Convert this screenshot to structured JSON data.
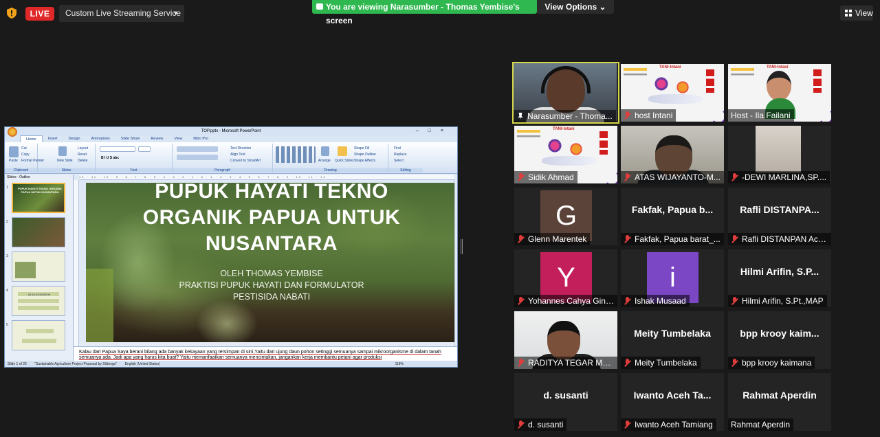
{
  "topbar": {
    "live_label": "LIVE",
    "stream_service": "Custom Live Streaming Service",
    "viewing_banner": "You are viewing Narasumber - Thomas Yembise's screen",
    "view_options": "View Options",
    "view_button": "View"
  },
  "ppt": {
    "window_title": "TOP.pptx - Microsoft PowerPoint",
    "tabs": [
      "Home",
      "Insert",
      "Design",
      "Animations",
      "Slide Show",
      "Review",
      "View",
      "Nitro Pro"
    ],
    "groups": [
      "Clipboard",
      "Slides",
      "Font",
      "Paragraph",
      "Drawing",
      "Editing"
    ],
    "clipboard": {
      "paste": "Paste",
      "cut": "Cut",
      "copy": "Copy",
      "format_painter": "Format Painter"
    },
    "slides_group": {
      "new_slide": "New Slide",
      "layout": "Layout",
      "reset": "Reset",
      "delete": "Delete"
    },
    "paragraph": {
      "text_direction": "Text Direction",
      "align_text": "Align Text",
      "convert": "Convert to SmartArt"
    },
    "drawing": {
      "arrange": "Arrange",
      "quick_styles": "Quick Styles",
      "shape_fill": "Shape Fill",
      "shape_outline": "Shape Outline",
      "shape_effects": "Shape Effects"
    },
    "editing": {
      "find": "Find",
      "replace": "Replace",
      "select": "Select"
    },
    "pane_tabs": [
      "Slides",
      "Outline"
    ],
    "thumbs": [
      {
        "num": "1",
        "text": "PUPUK HAYATI TEKNO ORGANIK PAPUA UNTUK NUSANTARA"
      },
      {
        "num": "2",
        "text": ""
      },
      {
        "num": "3",
        "text": ""
      },
      {
        "num": "4",
        "text": "01 02 03 04 05 06"
      },
      {
        "num": "5",
        "text": ""
      }
    ],
    "slide": {
      "title": "PUPUK HAYATI TEKNO ORGANIK PAPUA UNTUK NUSANTARA",
      "line1": "OLEH THOMAS YEMBISE",
      "line2": "PRAKTISI PUPUK HAYATI DAN FORMULATOR",
      "line3": "PESTISIDA NABATI"
    },
    "notes": "Kalau dari Papua Saya berani bilang ada banyak kekayaan yang tersimpan di sini,Yaitu dari ujung daun pohon setinggi semuanya sampai mikroorganisme di dalam tanah semuanya ada. Jadi apa yang harus kita buat? Yaitu memanfaatkan semuanya mencintakan, jangankan kerja membantu petani agar produksi",
    "status": {
      "slide": "Slide 1 of 26",
      "theme": "\"Sustainable Agriculture Project Proposal by Slidesgo\"",
      "lang": "English (United States)",
      "zoom": "118%"
    }
  },
  "tiles": [
    {
      "name": "Narasumber - Thomas Yembise",
      "kind": "host-video",
      "active": true,
      "icon": "pin-icon"
    },
    {
      "name": "host Intani",
      "kind": "poster",
      "icon": "mic-muted-icon"
    },
    {
      "name": "Host - Ila Failani",
      "kind": "woman-video",
      "icon": "none"
    },
    {
      "name": "Sidik Ahmad",
      "kind": "poster",
      "icon": "mic-muted-icon"
    },
    {
      "name": "ATAS WIJAYANTO-MAKASSAR",
      "kind": "man-video",
      "icon": "mic-muted-icon"
    },
    {
      "name": "-DEWI MARLINA,SP.M.Si",
      "kind": "dewi-video",
      "icon": "mic-muted-icon"
    },
    {
      "name": "Glenn Marentek",
      "kind": "avatar",
      "letter": "G",
      "color": "#5b4339",
      "icon": "mic-muted-icon"
    },
    {
      "name": "Fakfak, Papua barat_Ahmad",
      "big": "Fakfak, Papua barat_Ahmad",
      "kind": "text",
      "icon": "mic-muted-icon"
    },
    {
      "name": "Rafli DISTANPAN Aceh Tamiang",
      "big": "Rafli DISTANPAN Aceh Tamiang",
      "kind": "text",
      "icon": "mic-muted-icon"
    },
    {
      "name": "Yohannes Cahya Gintings",
      "kind": "avatar",
      "letter": "Y",
      "color": "#c31f5a",
      "icon": "mic-muted-icon"
    },
    {
      "name": "Ishak Musaad",
      "kind": "avatar",
      "letter": "i",
      "color": "#7b47c5",
      "icon": "mic-muted-icon"
    },
    {
      "name": "Hilmi Arifin, S.Pt.,MAP",
      "big": "Hilmi Arifin, S.Pt.,MAP",
      "kind": "text",
      "icon": "mic-muted-icon"
    },
    {
      "name": "RADITYA TEGAR MAHENDRA",
      "kind": "boy-video",
      "icon": "mic-muted-icon"
    },
    {
      "name": "Meity Tumbelaka",
      "big": "Meity Tumbelaka",
      "kind": "text",
      "icon": "mic-muted-icon"
    },
    {
      "name": "bpp kroy kaimana",
      "big": "bpp krooy kaimana",
      "kind": "text",
      "icon": "mic-muted-icon"
    },
    {
      "name": "d. susanti",
      "big": "d. susanti",
      "kind": "text",
      "icon": "mic-muted-icon"
    },
    {
      "name": "Iwanto Aceh Tamiang",
      "big": "Iwanto Aceh Tamiang",
      "kind": "text",
      "icon": "mic-muted-icon"
    },
    {
      "name": "Rahmat Aperdin",
      "big": "Rahmat Aperdin",
      "kind": "text",
      "icon": "none"
    }
  ],
  "labels": {
    "t0": "Narasumber - Thoma...",
    "t1": "host Intani",
    "t2": "Host - Ila Failani",
    "t3": "Sidik Ahmad",
    "t4": "ATAS WIJAYANTO-M...",
    "t5": "-DEWI MARLINA,SP....",
    "t6": "Glenn Marentek",
    "t7": "Fakfak, Papua barat_...",
    "t7big": "Fakfak, Papua b...",
    "t8": "Rafli DISTANPAN Ace...",
    "t8big": "Rafli DISTANPA...",
    "t9": "Yohannes Cahya Ginti...",
    "t10": "Ishak Musaad",
    "t11": "Hilmi Arifin, S.Pt.,MAP",
    "t11big": "Hilmi Arifin, S.P...",
    "t12": "RADITYA TEGAR MAH...",
    "t13": "Meity Tumbelaka",
    "t13big": "Meity Tumbelaka",
    "t14": "bpp krooy kaimana",
    "t14big": "bpp krooy kaim...",
    "t15": "d. susanti",
    "t15big": "d. susanti",
    "t16": "Iwanto Aceh Tamiang",
    "t16big": "Iwanto Aceh Ta...",
    "t17": "Rahmat Aperdin",
    "t17big": "Rahmat Aperdin"
  }
}
